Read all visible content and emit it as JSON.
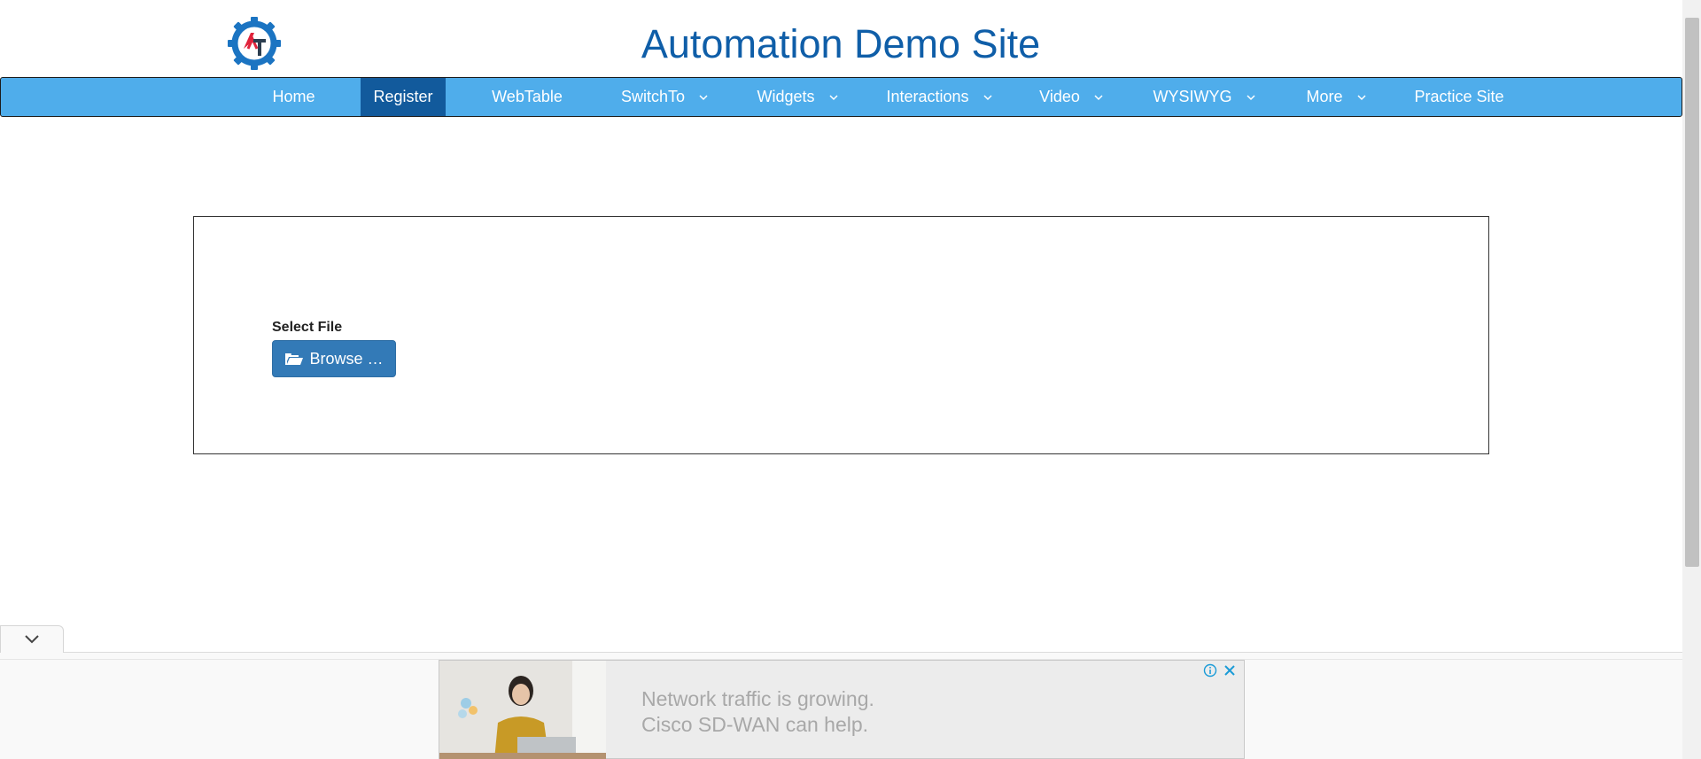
{
  "header": {
    "title": "Automation Demo Site",
    "logo_icon": "gear-at-logo-icon"
  },
  "nav": {
    "items": [
      {
        "label": "Home",
        "has_dropdown": false,
        "active": false
      },
      {
        "label": "Register",
        "has_dropdown": false,
        "active": true
      },
      {
        "label": "WebTable",
        "has_dropdown": false,
        "active": false
      },
      {
        "label": "SwitchTo",
        "has_dropdown": true,
        "active": false
      },
      {
        "label": "Widgets",
        "has_dropdown": true,
        "active": false
      },
      {
        "label": "Interactions",
        "has_dropdown": true,
        "active": false
      },
      {
        "label": "Video",
        "has_dropdown": true,
        "active": false
      },
      {
        "label": "WYSIWYG",
        "has_dropdown": true,
        "active": false
      },
      {
        "label": "More",
        "has_dropdown": true,
        "active": false
      },
      {
        "label": "Practice Site",
        "has_dropdown": false,
        "active": false
      }
    ]
  },
  "upload": {
    "label": "Select File",
    "browse_label": "Browse …",
    "browse_icon": "folder-open-icon"
  },
  "ad": {
    "line1": "Network traffic is growing.",
    "line2": "Cisco SD-WAN can help."
  },
  "colors": {
    "nav_bg": "#4fadeb",
    "nav_active": "#125a9c",
    "title": "#0f5ea8",
    "button": "#337ab7"
  }
}
